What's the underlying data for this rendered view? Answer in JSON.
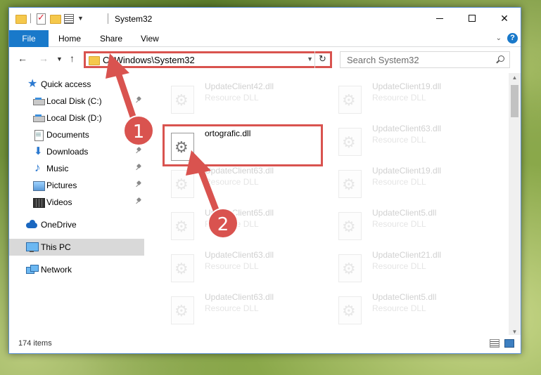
{
  "window": {
    "title": "System32",
    "ribbon_tabs": [
      "File",
      "Home",
      "Share",
      "View"
    ],
    "help_label": "?",
    "controls": {
      "minimize": "—",
      "maximize": "☐",
      "close": "✕"
    }
  },
  "address": {
    "path": "C:\\Windows\\System32",
    "search_placeholder": "Search System32"
  },
  "sidebar": {
    "items": [
      {
        "label": "Quick access",
        "icon": "star-icon",
        "pinned": false
      },
      {
        "label": "Local Disk (C:)",
        "icon": "disk-icon",
        "pinned": true
      },
      {
        "label": "Local Disk (D:)",
        "icon": "disk-icon",
        "pinned": false
      },
      {
        "label": "Documents",
        "icon": "document-icon",
        "pinned": false
      },
      {
        "label": "Downloads",
        "icon": "download-icon",
        "pinned": true
      },
      {
        "label": "Music",
        "icon": "music-icon",
        "pinned": true
      },
      {
        "label": "Pictures",
        "icon": "pictures-icon",
        "pinned": true
      },
      {
        "label": "Videos",
        "icon": "videos-icon",
        "pinned": true
      },
      {
        "label": "OneDrive",
        "icon": "cloud-icon",
        "pinned": false
      },
      {
        "label": "This PC",
        "icon": "computer-icon",
        "pinned": false,
        "selected": true
      },
      {
        "label": "Network",
        "icon": "network-icon",
        "pinned": false
      }
    ]
  },
  "files": {
    "left_column": [
      {
        "name": "UpdateClient42.dll",
        "type": "Resource DLL"
      },
      {
        "name": "ortografic.dll",
        "type": "",
        "highlighted": true
      },
      {
        "name": "UpdateClient63.dll",
        "type": "Resource DLL"
      },
      {
        "name": "UpdateClient65.dll",
        "type": "Resource DLL"
      },
      {
        "name": "UpdateClient63.dll",
        "type": "Resource DLL"
      },
      {
        "name": "UpdateClient63.dll",
        "type": "Resource DLL"
      }
    ],
    "right_column": [
      {
        "name": "UpdateClient19.dll",
        "type": "Resource DLL"
      },
      {
        "name": "UpdateClient63.dll",
        "type": "Resource DLL"
      },
      {
        "name": "UpdateClient19.dll",
        "type": "Resource DLL"
      },
      {
        "name": "UpdateClient5.dll",
        "type": "Resource DLL"
      },
      {
        "name": "UpdateClient21.dll",
        "type": "Resource DLL"
      },
      {
        "name": "UpdateClient5.dll",
        "type": "Resource DLL"
      }
    ]
  },
  "status": {
    "item_count": "174 items"
  },
  "annotations": {
    "step1": "1",
    "step2": "2"
  },
  "colors": {
    "accent": "#1979ca",
    "annotation": "#d9534f"
  }
}
